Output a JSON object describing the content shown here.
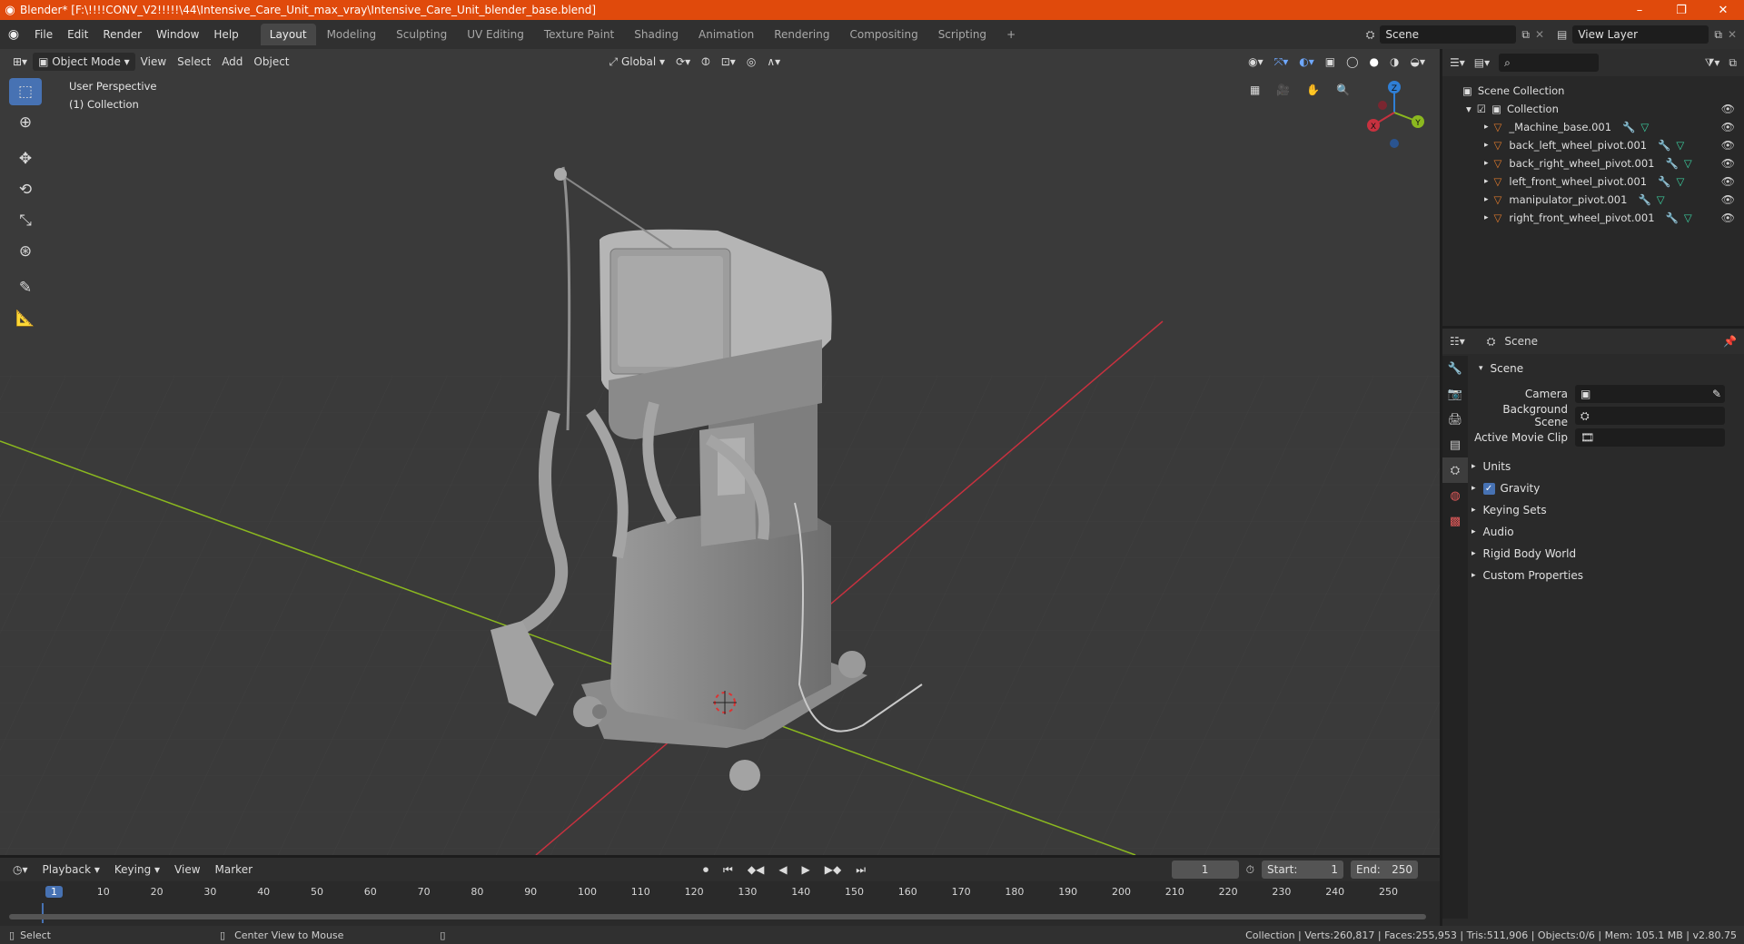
{
  "window": {
    "title": "Blender* [F:\\!!!!CONV_V2!!!!!\\44\\Intensive_Care_Unit_max_vray\\Intensive_Care_Unit_blender_base.blend]",
    "minimize": "–",
    "maximize": "❐",
    "close": "✕"
  },
  "menu": [
    "File",
    "Edit",
    "Render",
    "Window",
    "Help"
  ],
  "workspaces": [
    "Layout",
    "Modeling",
    "Sculpting",
    "UV Editing",
    "Texture Paint",
    "Shading",
    "Animation",
    "Rendering",
    "Compositing",
    "Scripting"
  ],
  "active_workspace": "Layout",
  "add_workspace": "+",
  "scene_selector": "Scene",
  "view_layer_selector": "View Layer",
  "viewport_header": {
    "mode": "Object Mode",
    "view": "View",
    "select": "Select",
    "add": "Add",
    "object": "Object",
    "transform_orientation": "Global"
  },
  "viewport_overlay": {
    "perspective": "User Perspective",
    "collection": "(1) Collection"
  },
  "gizmo": {
    "x": "X",
    "y": "Y",
    "z": "Z"
  },
  "outliner": {
    "scene_collection": "Scene Collection",
    "collection": "Collection",
    "items": [
      "_Machine_base.001",
      "back_left_wheel_pivot.001",
      "back_right_wheel_pivot.001",
      "left_front_wheel_pivot.001",
      "manipulator_pivot.001",
      "right_front_wheel_pivot.001"
    ]
  },
  "properties": {
    "header": "Scene",
    "panel": "Scene",
    "camera_label": "Camera",
    "background_scene_label": "Background Scene",
    "active_movie_clip_label": "Active Movie Clip",
    "sections": [
      "Units",
      "Gravity",
      "Keying Sets",
      "Audio",
      "Rigid Body World",
      "Custom Properties"
    ]
  },
  "timeline": {
    "playback": "Playback",
    "keying": "Keying",
    "view": "View",
    "marker": "Marker",
    "current_frame": "1",
    "start_label": "Start:",
    "start": "1",
    "end_label": "End:",
    "end": "250",
    "ticks": [
      "1",
      "10",
      "20",
      "30",
      "40",
      "50",
      "60",
      "70",
      "80",
      "90",
      "100",
      "110",
      "120",
      "130",
      "140",
      "150",
      "160",
      "170",
      "180",
      "190",
      "200",
      "210",
      "220",
      "230",
      "240",
      "250"
    ]
  },
  "status": {
    "select": "Select",
    "center_view": "Center View to Mouse",
    "stats": "Collection | Verts:260,817 | Faces:255,953 | Tris:511,906 | Objects:0/6 | Mem: 105.1 MB | v2.80.75"
  },
  "colors": {
    "titlebar": "#e04a0c",
    "accent": "#4772b3",
    "x_axis": "#c7313f",
    "y_axis": "#8bb81f",
    "z_axis": "#2f7fd6",
    "mesh_icon": "#e07a2c"
  }
}
